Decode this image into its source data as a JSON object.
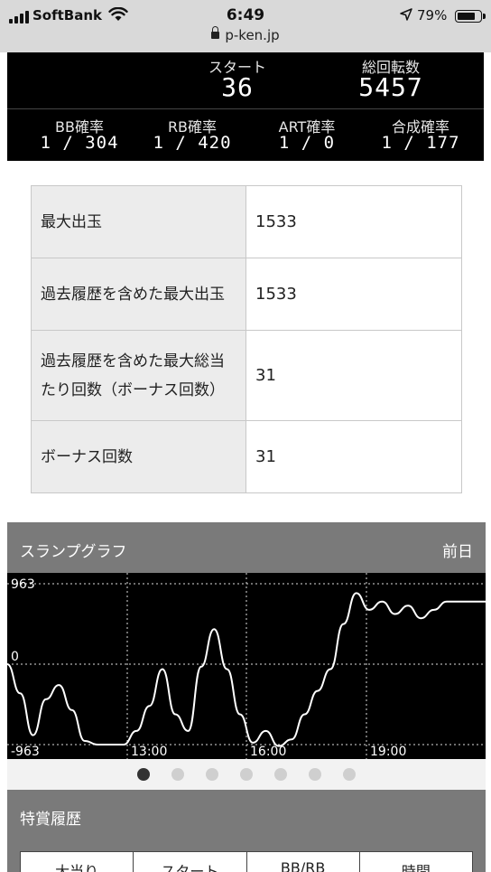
{
  "status_bar": {
    "carrier": "SoftBank",
    "time": "6:49",
    "battery_percent": "79%",
    "battery_level": 0.79,
    "url": "p-ken.jp"
  },
  "counter": {
    "start_label": "スタート",
    "start_value": "36",
    "total_label": "総回転数",
    "total_value": "5457",
    "rates": [
      {
        "label": "BB確率",
        "value": "1 / 304"
      },
      {
        "label": "RB確率",
        "value": "1 / 420"
      },
      {
        "label": "ART確率",
        "value": "1 / 0"
      },
      {
        "label": "合成確率",
        "value": "1 / 177"
      }
    ]
  },
  "info_table": [
    {
      "key": "最大出玉",
      "value": "1533"
    },
    {
      "key": "過去履歴を含めた最大出玉",
      "value": "1533"
    },
    {
      "key": "過去履歴を含めた最大総当たり回数（ボーナス回数）",
      "value": "31"
    },
    {
      "key": "ボーナス回数",
      "value": "31"
    }
  ],
  "graph": {
    "title": "スランプグラフ",
    "day_label": "前日",
    "pages": 7,
    "active_page": 0
  },
  "chart_data": {
    "type": "line",
    "ylim": [
      -963,
      963
    ],
    "y_tick_labels": [
      "963",
      "0",
      "-963"
    ],
    "x_tick_labels": [
      "13:00",
      "16:00",
      "19:00"
    ],
    "grid": true,
    "series": [
      {
        "values": [
          0,
          -350,
          -850,
          -420,
          -250,
          -550,
          -920,
          -963,
          -963,
          -963,
          -800,
          -500,
          -60,
          -600,
          -800,
          -30,
          420,
          -60,
          -600,
          -940,
          -800,
          -980,
          -900,
          -600,
          -320,
          -60,
          480,
          850,
          650,
          750,
          600,
          700,
          550,
          650,
          750,
          750,
          750,
          750
        ]
      }
    ]
  },
  "history": {
    "title": "特賞履歴",
    "columns": [
      "大当り",
      "スタート",
      "BB/RB",
      "時間"
    ]
  }
}
